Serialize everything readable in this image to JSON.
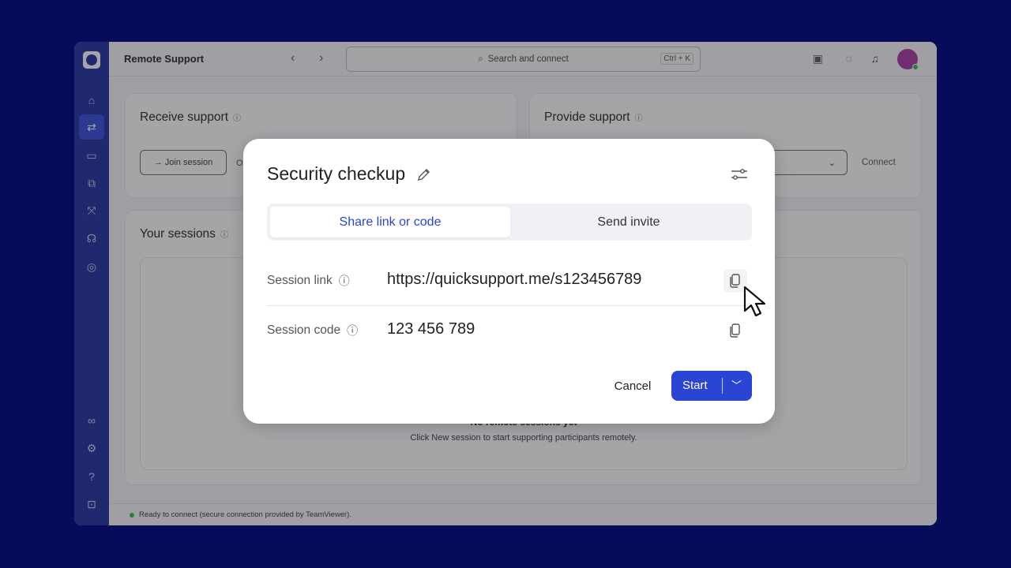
{
  "app": {
    "title": "Remote Support",
    "search_placeholder": "Search and connect",
    "search_shortcut": "Ctrl + K"
  },
  "sidebar": {
    "items": [
      "home",
      "remote-support",
      "devices",
      "sessions",
      "integrations",
      "support",
      "monitoring",
      "connections",
      "settings",
      "help",
      "collapse"
    ]
  },
  "receive": {
    "title": "Receive support",
    "join_label": "Join session",
    "or": "Or"
  },
  "provide": {
    "title": "Provide support",
    "connect_label": "Connect"
  },
  "sessions": {
    "title": "Your sessions",
    "empty_title": "No remote sessions yet",
    "empty_sub": "Click New session to start supporting participants remotely."
  },
  "status": {
    "text": "Ready to connect (secure connection provided by TeamViewer).",
    "color": "#2fb94a"
  },
  "modal": {
    "title": "Security checkup",
    "tabs": [
      {
        "label": "Share link or code",
        "active": true
      },
      {
        "label": "Send invite",
        "active": false
      }
    ],
    "link_label": "Session link",
    "link_value": "https://quicksupport.me/s123456789",
    "code_label": "Session code",
    "code_value": "123 456 789",
    "cancel_label": "Cancel",
    "start_label": "Start"
  },
  "colors": {
    "accent": "#2a44d4",
    "background": "#060b5a",
    "sidebar": "#1a2a9a",
    "avatar": "#a8309f"
  }
}
